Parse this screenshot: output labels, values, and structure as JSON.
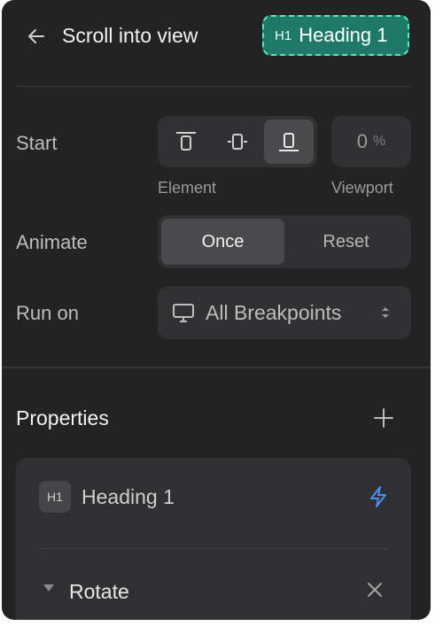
{
  "header": {
    "title": "Scroll into view",
    "badge": {
      "tag": "H1",
      "label": "Heading 1",
      "color": "#1e7a67",
      "border": "#5ee6c3"
    }
  },
  "start": {
    "label": "Start",
    "alignment_options": [
      "align-top-icon",
      "align-middle-icon",
      "align-bottom-icon"
    ],
    "selected_alignment": "align-bottom-icon",
    "element_caption": "Element",
    "viewport_value": "0",
    "viewport_unit": "%",
    "viewport_caption": "Viewport"
  },
  "animate": {
    "label": "Animate",
    "options": [
      "Once",
      "Reset"
    ],
    "selected": "Once"
  },
  "run_on": {
    "label": "Run on",
    "value": "All Breakpoints",
    "icon": "monitor-icon"
  },
  "properties": {
    "title": "Properties",
    "card": {
      "tag": "H1",
      "name": "Heading 1",
      "action_icon": "lightning-icon",
      "accent": "#4c8ef7",
      "property_name": "Rotate"
    }
  }
}
